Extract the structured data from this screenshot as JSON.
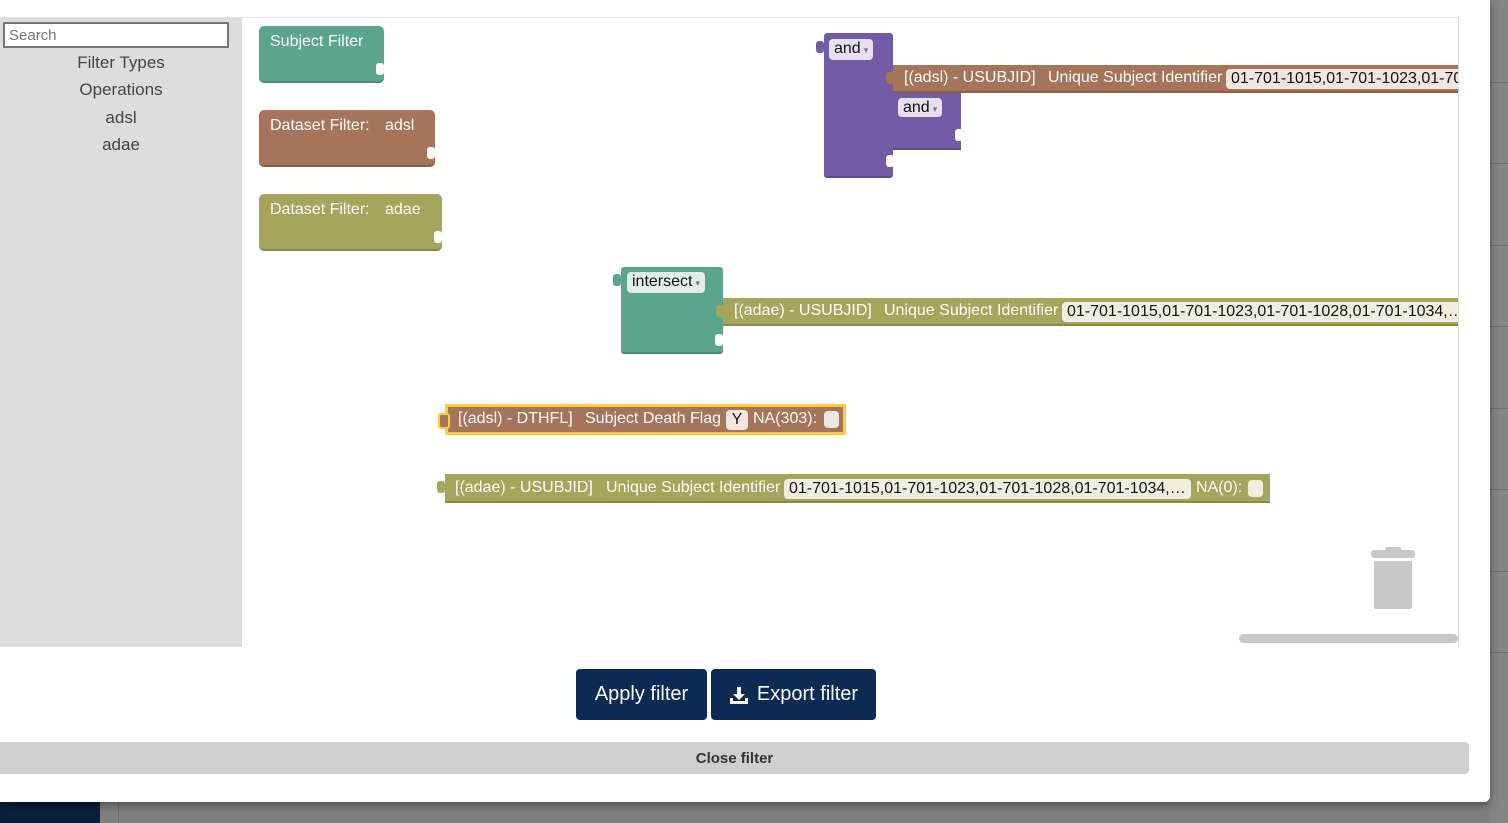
{
  "toolbox": {
    "search_placeholder": "Search",
    "categories": [
      "Filter Types",
      "Operations",
      "adsl",
      "adae"
    ]
  },
  "workspace": {
    "subject_filter": "Subject Filter",
    "dataset_filter_label": "Dataset Filter:",
    "dataset_adsl": "adsl",
    "dataset_adae": "adae",
    "and_op_1": "and",
    "and_op_2": "and",
    "adsl_usubjid_block": {
      "var": "[(adsl) - USUBJID]",
      "label": "Unique Subject Identifier",
      "value": "01-701-1015,01-701-1023,01-70"
    },
    "intersect_op": "intersect",
    "adae_usubjid_block_attached": {
      "var": "[(adae) - USUBJID]",
      "label": "Unique Subject Identifier",
      "value": "01-701-1015,01-701-1023,01-701-1028,01-701-1034,…"
    },
    "dthfl_block": {
      "var": "[(adsl) - DTHFL]",
      "label": "Subject Death Flag",
      "value": "Y",
      "na_label": "NA(303):"
    },
    "adae_usubjid_block_free": {
      "var": "[(adae) - USUBJID]",
      "label": "Unique Subject Identifier",
      "value": "01-701-1015,01-701-1023,01-701-1028,01-701-1034,…",
      "na_label": "NA(0):"
    },
    "colors": {
      "subject": "#5ba58c",
      "adsl": "#a5745b",
      "adae": "#a5a55b",
      "logic": "#745ba5",
      "selected": "#fc3"
    }
  },
  "footer": {
    "apply_label": "Apply filter",
    "export_label": "Export filter",
    "close_label": "Close filter"
  }
}
